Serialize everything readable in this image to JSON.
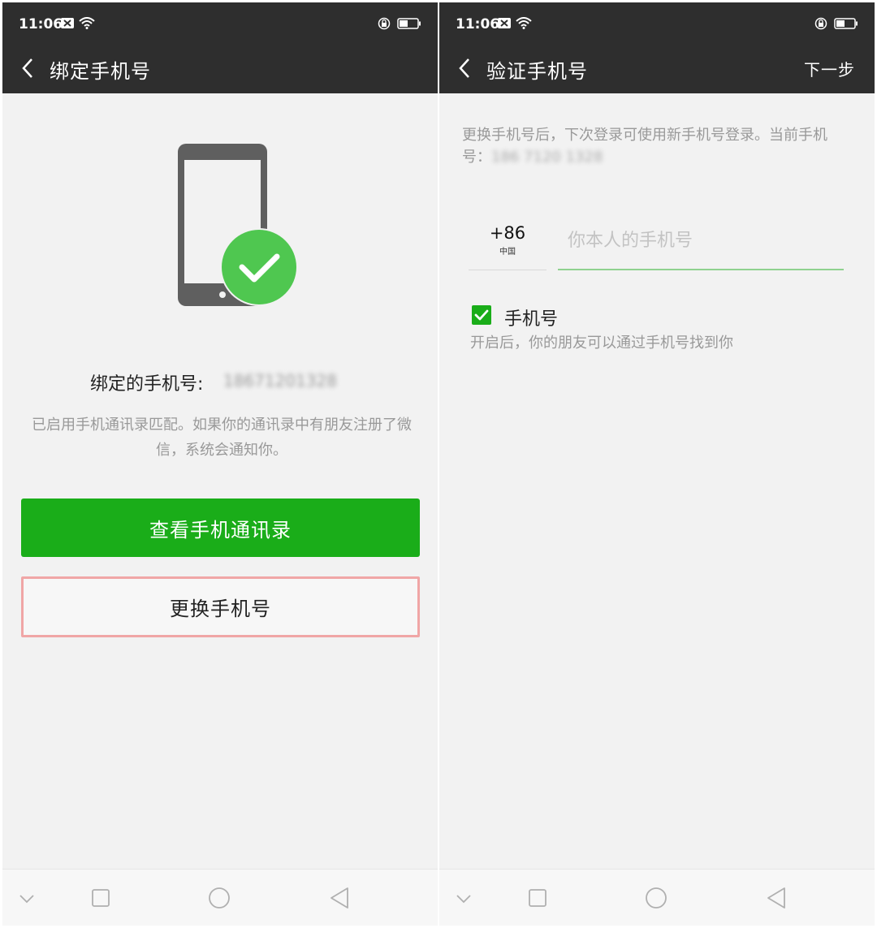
{
  "status": {
    "time": "11:06"
  },
  "left": {
    "title": "绑定手机号",
    "bound_label": "绑定的手机号:",
    "bound_number": "18671201328",
    "description": "已启用手机通讯录匹配。如果你的通讯录中有朋友注册了微信，系统会通知你。",
    "view_contacts_button": "查看手机通讯录",
    "change_number_button": "更换手机号"
  },
  "right": {
    "title": "验证手机号",
    "next_button": "下一步",
    "hint": "更换手机号后，下次登录可使用新手机号登录。当前手机号：",
    "current_number": "186 7120 1328",
    "country_code": "+86",
    "country_name": "中国",
    "phone_placeholder": "你本人的手机号",
    "phone_value": "",
    "checkbox_label": "手机号",
    "checkbox_checked": true,
    "checkbox_desc": "开启后，你的朋友可以通过手机号找到你"
  },
  "colors": {
    "header": "#2e2e2e",
    "primary_green": "#1aad19",
    "check_green": "#4fc750",
    "highlight_border": "#f0a6a6",
    "background": "#f2f2f2"
  },
  "icons": {
    "back": "chevron-left-icon",
    "check_badge": "checkmark-circle-icon",
    "nav": [
      "chevron-down-icon",
      "square-icon",
      "circle-icon",
      "triangle-back-icon"
    ]
  }
}
